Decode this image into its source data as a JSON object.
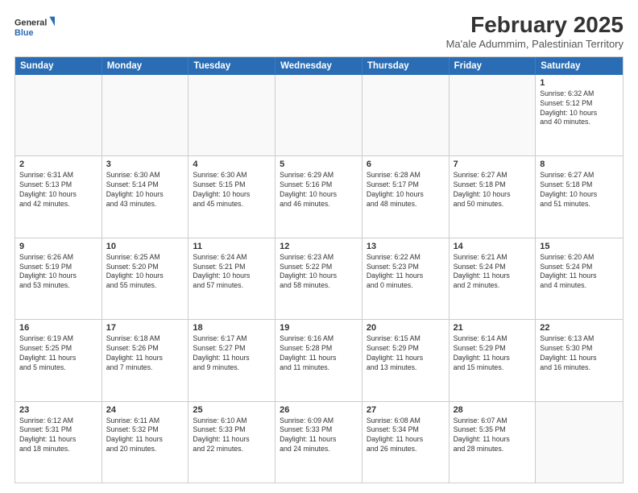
{
  "logo": {
    "line1": "General",
    "line2": "Blue",
    "icon_color": "#2a6db5"
  },
  "title": "February 2025",
  "subtitle": "Ma'ale Adummim, Palestinian Territory",
  "header_days": [
    "Sunday",
    "Monday",
    "Tuesday",
    "Wednesday",
    "Thursday",
    "Friday",
    "Saturday"
  ],
  "weeks": [
    [
      {
        "day": "",
        "text": ""
      },
      {
        "day": "",
        "text": ""
      },
      {
        "day": "",
        "text": ""
      },
      {
        "day": "",
        "text": ""
      },
      {
        "day": "",
        "text": ""
      },
      {
        "day": "",
        "text": ""
      },
      {
        "day": "1",
        "text": "Sunrise: 6:32 AM\nSunset: 5:12 PM\nDaylight: 10 hours\nand 40 minutes."
      }
    ],
    [
      {
        "day": "2",
        "text": "Sunrise: 6:31 AM\nSunset: 5:13 PM\nDaylight: 10 hours\nand 42 minutes."
      },
      {
        "day": "3",
        "text": "Sunrise: 6:30 AM\nSunset: 5:14 PM\nDaylight: 10 hours\nand 43 minutes."
      },
      {
        "day": "4",
        "text": "Sunrise: 6:30 AM\nSunset: 5:15 PM\nDaylight: 10 hours\nand 45 minutes."
      },
      {
        "day": "5",
        "text": "Sunrise: 6:29 AM\nSunset: 5:16 PM\nDaylight: 10 hours\nand 46 minutes."
      },
      {
        "day": "6",
        "text": "Sunrise: 6:28 AM\nSunset: 5:17 PM\nDaylight: 10 hours\nand 48 minutes."
      },
      {
        "day": "7",
        "text": "Sunrise: 6:27 AM\nSunset: 5:18 PM\nDaylight: 10 hours\nand 50 minutes."
      },
      {
        "day": "8",
        "text": "Sunrise: 6:27 AM\nSunset: 5:18 PM\nDaylight: 10 hours\nand 51 minutes."
      }
    ],
    [
      {
        "day": "9",
        "text": "Sunrise: 6:26 AM\nSunset: 5:19 PM\nDaylight: 10 hours\nand 53 minutes."
      },
      {
        "day": "10",
        "text": "Sunrise: 6:25 AM\nSunset: 5:20 PM\nDaylight: 10 hours\nand 55 minutes."
      },
      {
        "day": "11",
        "text": "Sunrise: 6:24 AM\nSunset: 5:21 PM\nDaylight: 10 hours\nand 57 minutes."
      },
      {
        "day": "12",
        "text": "Sunrise: 6:23 AM\nSunset: 5:22 PM\nDaylight: 10 hours\nand 58 minutes."
      },
      {
        "day": "13",
        "text": "Sunrise: 6:22 AM\nSunset: 5:23 PM\nDaylight: 11 hours\nand 0 minutes."
      },
      {
        "day": "14",
        "text": "Sunrise: 6:21 AM\nSunset: 5:24 PM\nDaylight: 11 hours\nand 2 minutes."
      },
      {
        "day": "15",
        "text": "Sunrise: 6:20 AM\nSunset: 5:24 PM\nDaylight: 11 hours\nand 4 minutes."
      }
    ],
    [
      {
        "day": "16",
        "text": "Sunrise: 6:19 AM\nSunset: 5:25 PM\nDaylight: 11 hours\nand 5 minutes."
      },
      {
        "day": "17",
        "text": "Sunrise: 6:18 AM\nSunset: 5:26 PM\nDaylight: 11 hours\nand 7 minutes."
      },
      {
        "day": "18",
        "text": "Sunrise: 6:17 AM\nSunset: 5:27 PM\nDaylight: 11 hours\nand 9 minutes."
      },
      {
        "day": "19",
        "text": "Sunrise: 6:16 AM\nSunset: 5:28 PM\nDaylight: 11 hours\nand 11 minutes."
      },
      {
        "day": "20",
        "text": "Sunrise: 6:15 AM\nSunset: 5:29 PM\nDaylight: 11 hours\nand 13 minutes."
      },
      {
        "day": "21",
        "text": "Sunrise: 6:14 AM\nSunset: 5:29 PM\nDaylight: 11 hours\nand 15 minutes."
      },
      {
        "day": "22",
        "text": "Sunrise: 6:13 AM\nSunset: 5:30 PM\nDaylight: 11 hours\nand 16 minutes."
      }
    ],
    [
      {
        "day": "23",
        "text": "Sunrise: 6:12 AM\nSunset: 5:31 PM\nDaylight: 11 hours\nand 18 minutes."
      },
      {
        "day": "24",
        "text": "Sunrise: 6:11 AM\nSunset: 5:32 PM\nDaylight: 11 hours\nand 20 minutes."
      },
      {
        "day": "25",
        "text": "Sunrise: 6:10 AM\nSunset: 5:33 PM\nDaylight: 11 hours\nand 22 minutes."
      },
      {
        "day": "26",
        "text": "Sunrise: 6:09 AM\nSunset: 5:33 PM\nDaylight: 11 hours\nand 24 minutes."
      },
      {
        "day": "27",
        "text": "Sunrise: 6:08 AM\nSunset: 5:34 PM\nDaylight: 11 hours\nand 26 minutes."
      },
      {
        "day": "28",
        "text": "Sunrise: 6:07 AM\nSunset: 5:35 PM\nDaylight: 11 hours\nand 28 minutes."
      },
      {
        "day": "",
        "text": ""
      }
    ]
  ]
}
